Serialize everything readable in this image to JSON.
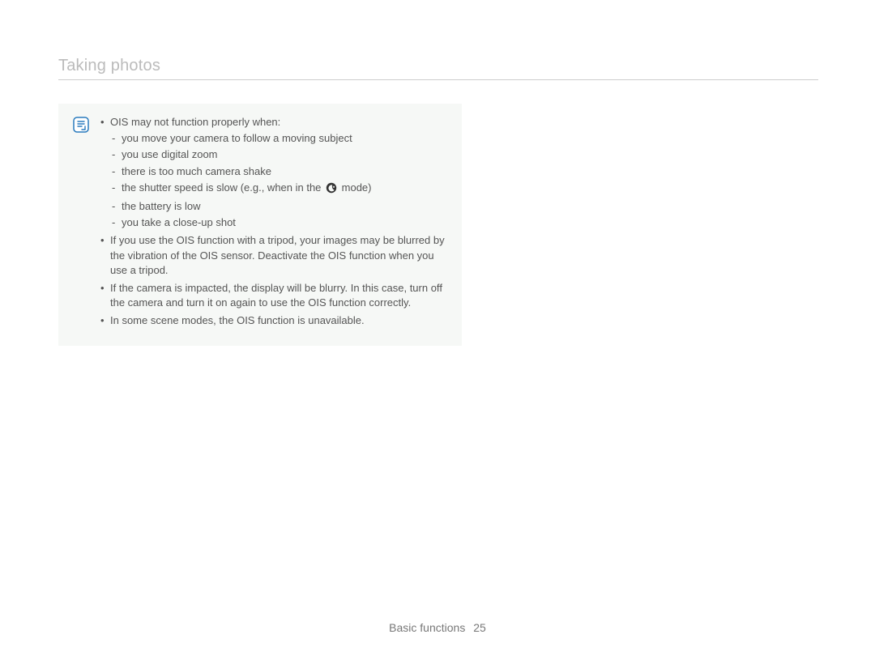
{
  "title": "Taking photos",
  "note": {
    "icon": "note-icon",
    "bullets": [
      {
        "text": "OIS may not function properly when:",
        "sub": [
          "you move your camera to follow a moving subject",
          "you use digital zoom",
          "there is too much camera shake",
          {
            "before": "the shutter speed is slow (e.g., when in the ",
            "icon": "night-mode-icon",
            "after": " mode)"
          },
          "the battery is low",
          "you take a close-up shot"
        ]
      },
      {
        "text": "If you use the OIS function with a tripod, your images may be blurred by the vibration of the OIS sensor. Deactivate the OIS function when you use a tripod."
      },
      {
        "text": "If the camera is impacted, the display will be blurry. In this case, turn off the camera and turn it on again to use the OIS function correctly."
      },
      {
        "text": "In some scene modes, the OIS function is unavailable."
      }
    ]
  },
  "footer": {
    "section": "Basic functions",
    "page": "25"
  }
}
